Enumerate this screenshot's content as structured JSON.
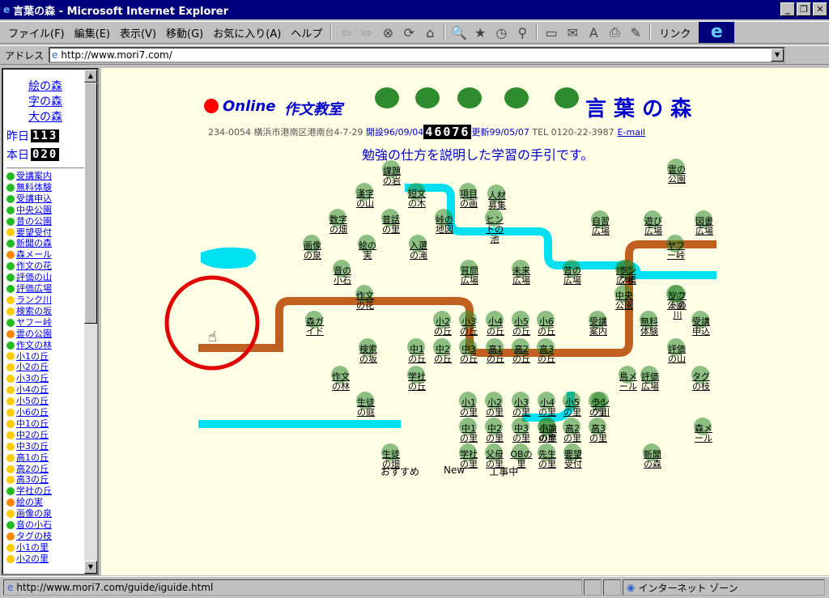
{
  "window": {
    "title": "言葉の森 - Microsoft Internet Explorer"
  },
  "menu": [
    "ファイル(F)",
    "編集(E)",
    "表示(V)",
    "移動(G)",
    "お気に入り(A)",
    "ヘルプ"
  ],
  "toolbar": {
    "links_label": "リンク"
  },
  "address": {
    "label": "アドレス",
    "url": "http://www.mori7.com/"
  },
  "left": {
    "top_links": [
      "絵の森",
      "字の森",
      "大の森"
    ],
    "counters": [
      {
        "label": "昨日",
        "value": "113"
      },
      {
        "label": "本日",
        "value": "020"
      }
    ],
    "items": [
      {
        "t": "受講案内",
        "c": "#22bb22"
      },
      {
        "t": "無料体験",
        "c": "#22bb22"
      },
      {
        "t": "受講申込",
        "c": "#22bb22"
      },
      {
        "t": "中央公園",
        "c": "#22bb22"
      },
      {
        "t": "昔の公園",
        "c": "#22bb22"
      },
      {
        "t": "要望受付",
        "c": "#ffcc00"
      },
      {
        "t": "新聞の森",
        "c": "#22bb22"
      },
      {
        "t": "森メール",
        "c": "#ff8800"
      },
      {
        "t": "作文の花",
        "c": "#22bb22"
      },
      {
        "t": "評価の山",
        "c": "#22bb22"
      },
      {
        "t": "評価広場",
        "c": "#22bb22"
      },
      {
        "t": "ランク川",
        "c": "#ffcc00"
      },
      {
        "t": "検索の坂",
        "c": "#ffcc00"
      },
      {
        "t": "ヤフー峠",
        "c": "#22bb22"
      },
      {
        "t": "雲の公園",
        "c": "#ff8800"
      },
      {
        "t": "作文の林",
        "c": "#22bb22"
      },
      {
        "t": "小1の丘",
        "c": "#ffcc00"
      },
      {
        "t": "小2の丘",
        "c": "#ffcc00"
      },
      {
        "t": "小3の丘",
        "c": "#ffcc00"
      },
      {
        "t": "小4の丘",
        "c": "#ffcc00"
      },
      {
        "t": "小5の丘",
        "c": "#ffcc00"
      },
      {
        "t": "小6の丘",
        "c": "#ffcc00"
      },
      {
        "t": "中1の丘",
        "c": "#ffcc00"
      },
      {
        "t": "中2の丘",
        "c": "#ffcc00"
      },
      {
        "t": "中3の丘",
        "c": "#ffcc00"
      },
      {
        "t": "高1の丘",
        "c": "#ffcc00"
      },
      {
        "t": "高2の丘",
        "c": "#ffcc00"
      },
      {
        "t": "高3の丘",
        "c": "#ffcc00"
      },
      {
        "t": "学社の丘",
        "c": "#22bb22"
      },
      {
        "t": "絵の実",
        "c": "#ff8800"
      },
      {
        "t": "画像の泉",
        "c": "#ffcc00"
      },
      {
        "t": "音の小石",
        "c": "#22bb22"
      },
      {
        "t": "タグの枝",
        "c": "#ff8800"
      },
      {
        "t": "小1の里",
        "c": "#ffcc00"
      },
      {
        "t": "小2の里",
        "c": "#ffcc00"
      }
    ]
  },
  "main": {
    "online": "Online",
    "sakubun": "作文教室",
    "title": "言 葉 の 森",
    "address": "234-0054 横浜市港南区港南台4-7-29",
    "opened": "開設96/09/04",
    "counter": "46076",
    "updated": "更新99/05/07",
    "tel": "TEL 0120-22-3987",
    "email": "E-mail",
    "subtitle": "勉強の仕方を説明した学習の手引です。",
    "labels": [
      [
        "課題の岩",
        345,
        112
      ],
      [
        "漢字の山",
        312,
        140
      ],
      [
        "短文の木",
        376,
        140
      ],
      [
        "項目の画",
        440,
        140
      ],
      [
        "雲の公園",
        697,
        110
      ],
      [
        "人材募集",
        475,
        142
      ],
      [
        "数字の畑",
        279,
        172
      ],
      [
        "昔話の里",
        344,
        172
      ],
      [
        "峠の地図",
        410,
        172
      ],
      [
        "ヒントの池",
        472,
        172
      ],
      [
        "自習広場",
        603,
        174
      ],
      [
        "遊び広場",
        668,
        174
      ],
      [
        "図書広場",
        731,
        174
      ],
      [
        "画像の泉",
        247,
        204
      ],
      [
        "絵の実",
        315,
        204
      ],
      [
        "入選の滝",
        378,
        204
      ],
      [
        "ヤフー峠",
        696,
        204
      ],
      [
        "音の小石",
        284,
        235
      ],
      [
        "質問広場",
        441,
        235
      ],
      [
        "未来広場",
        505,
        235
      ],
      [
        "昔の広場",
        568,
        235
      ],
      [
        "練習広場",
        633,
        235
      ],
      [
        "ランク橋",
        636,
        235
      ],
      [
        "作文の花",
        312,
        266
      ],
      [
        "中央公園",
        632,
        266
      ],
      [
        "昔の公園",
        696,
        266
      ],
      [
        "ソフトの川",
        698,
        266
      ],
      [
        "森ガイド",
        250,
        298
      ],
      [
        "小2の丘",
        408,
        298
      ],
      [
        "小3の丘",
        440,
        298
      ],
      [
        "小4の丘",
        473,
        298
      ],
      [
        "小5の丘",
        505,
        298
      ],
      [
        "小6の丘",
        536,
        298
      ],
      [
        "受講案内",
        600,
        298
      ],
      [
        "無料体験",
        663,
        298
      ],
      [
        "受講申込",
        727,
        298
      ],
      [
        "検索の坂",
        316,
        332
      ],
      [
        "中1の丘",
        376,
        332
      ],
      [
        "中2の丘",
        408,
        332
      ],
      [
        "中3の丘",
        440,
        332
      ],
      [
        "高1の丘",
        473,
        332
      ],
      [
        "高2の丘",
        505,
        332
      ],
      [
        "高3の丘",
        536,
        332
      ],
      [
        "評価の山",
        697,
        332
      ],
      [
        "作文の林",
        282,
        366
      ],
      [
        "学社の丘",
        376,
        366
      ],
      [
        "鳥メール",
        637,
        366
      ],
      [
        "評価広場",
        664,
        366
      ],
      [
        "タグの枝",
        727,
        366
      ],
      [
        "生徒の庭",
        313,
        398
      ],
      [
        "小1の里",
        440,
        398
      ],
      [
        "小2の里",
        472,
        398
      ],
      [
        "小3の里",
        505,
        398
      ],
      [
        "小4の里",
        537,
        398
      ],
      [
        "小5の里",
        568,
        398
      ],
      [
        "小6の里",
        600,
        398
      ],
      [
        "ランク川",
        603,
        398
      ],
      [
        "中1の里",
        440,
        430
      ],
      [
        "中2の里",
        472,
        430
      ],
      [
        "中3の里",
        505,
        430
      ],
      [
        "高1の里",
        537,
        430
      ],
      [
        "高2の里",
        568,
        430
      ],
      [
        "高3の里",
        600,
        430
      ],
      [
        "小論の岸",
        538,
        430
      ],
      [
        "森メール",
        730,
        430
      ],
      [
        "生徒の畑",
        344,
        462
      ],
      [
        "学社の里",
        440,
        462
      ],
      [
        "父母の里",
        472,
        462
      ],
      [
        "OBの里",
        505,
        462
      ],
      [
        "先生の里",
        537,
        462
      ],
      [
        "要望受付",
        569,
        462
      ],
      [
        "新聞の森",
        667,
        462
      ]
    ],
    "footer": [
      "おすすめ",
      "New",
      "工事中"
    ]
  },
  "status": {
    "url": "http://www.mori7.com/guide/iguide.html",
    "zone": "インターネット ゾーン"
  }
}
